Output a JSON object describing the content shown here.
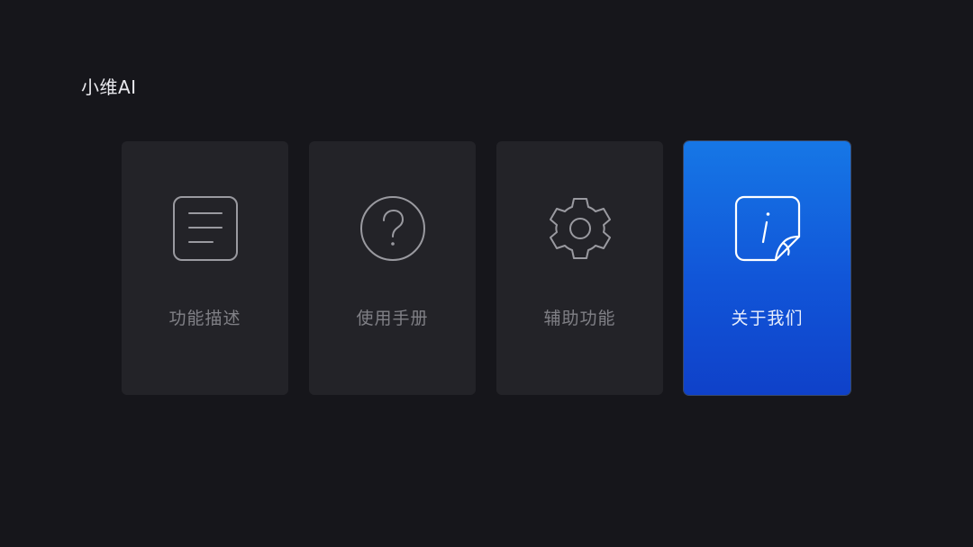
{
  "app": {
    "title": "小维AI"
  },
  "menu": {
    "items": [
      {
        "label": "功能描述",
        "icon": "document-list-icon",
        "focused": false
      },
      {
        "label": "使用手册",
        "icon": "question-circle-icon",
        "focused": false
      },
      {
        "label": "辅助功能",
        "icon": "gear-icon",
        "focused": false
      },
      {
        "label": "关于我们",
        "icon": "info-note-icon",
        "focused": true
      }
    ]
  },
  "colors": {
    "background": "#16161b",
    "card": "#232328",
    "focus_accent": "#1565e0",
    "label_inactive": "#808086",
    "label_active": "#e8eefc"
  }
}
